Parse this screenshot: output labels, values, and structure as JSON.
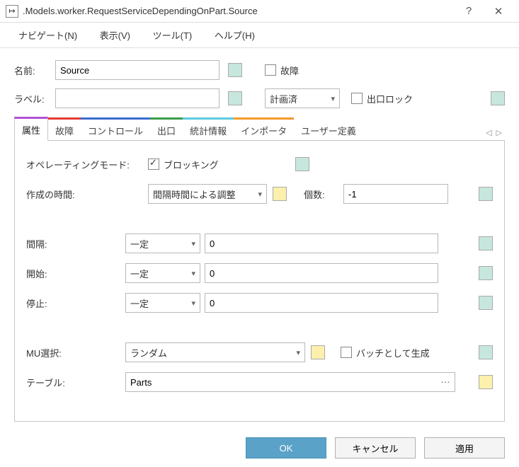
{
  "titlebar": {
    "icon": "↦",
    "text": ".Models.worker.RequestServiceDependingOnPart.Source",
    "help": "?",
    "close": "✕"
  },
  "menu": {
    "navigate": "ナビゲート(N)",
    "view": "表示(V)",
    "tools": "ツール(T)",
    "help": "ヘルプ(H)"
  },
  "header": {
    "name_label": "名前:",
    "name_value": "Source",
    "label_label": "ラベル:",
    "label_value": "",
    "failure_chk": "故障",
    "status_select": "計画済",
    "exit_lock": "出口ロック"
  },
  "tabs": {
    "attributes": "属性",
    "failure": "故障",
    "controls": "コントロール",
    "exit": "出口",
    "stats": "統計情報",
    "importer": "インポータ",
    "userdef": "ユーザー定義",
    "prev": "◁",
    "next": "▷"
  },
  "form": {
    "opmode_label": "オペレーティングモード:",
    "blocking": "ブロッキング",
    "ctime_label": "作成の時間:",
    "ctime_select": "間隔時間による調整",
    "count_label": "個数:",
    "count_value": "-1",
    "interval_label": "間隔:",
    "interval_select": "一定",
    "interval_value": "0",
    "start_label": "開始:",
    "start_select": "一定",
    "start_value": "0",
    "stop_label": "停止:",
    "stop_select": "一定",
    "stop_value": "0",
    "muselect_label": "MU選択:",
    "muselect_value": "ランダム",
    "batch_chk": "バッチとして生成",
    "table_label": "テーブル:",
    "table_value": "Parts"
  },
  "footer": {
    "ok": "OK",
    "cancel": "キャンセル",
    "apply": "適用"
  }
}
